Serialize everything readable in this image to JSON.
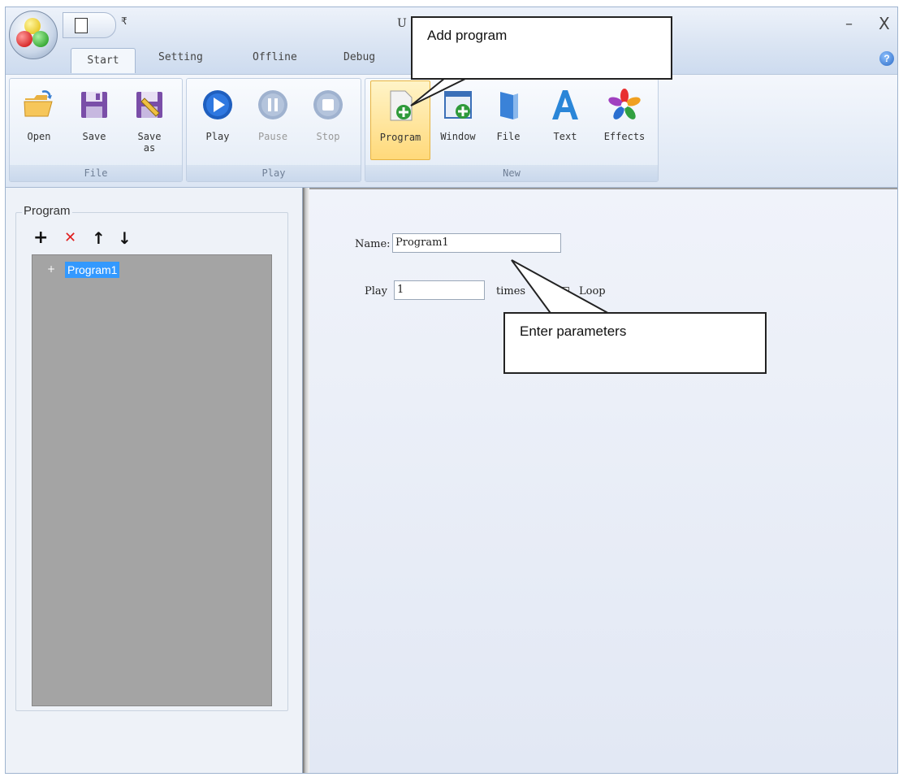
{
  "window": {
    "title": "U",
    "minimize_glyph": "–",
    "close_glyph": "X",
    "help_glyph": "?",
    "qat_dropdown_glyph": "₹"
  },
  "tabs": [
    "Start",
    "Setting",
    "Offline",
    "Debug"
  ],
  "ribbon": {
    "groups": {
      "file": {
        "label": "File",
        "buttons": [
          {
            "label": "Open",
            "icon": "folder-open-icon"
          },
          {
            "label": "Save",
            "icon": "floppy-disk-icon"
          },
          {
            "label": "Save\nas",
            "icon": "save-as-icon"
          }
        ]
      },
      "play": {
        "label": "Play",
        "buttons": [
          {
            "label": "Play",
            "icon": "play-icon"
          },
          {
            "label": "Pause",
            "icon": "pause-icon"
          },
          {
            "label": "Stop",
            "icon": "stop-icon"
          }
        ]
      },
      "new": {
        "label": "New",
        "buttons": [
          {
            "label": "Program",
            "icon": "new-program-icon"
          },
          {
            "label": "Window",
            "icon": "new-window-icon"
          },
          {
            "label": "File",
            "icon": "file-icon"
          },
          {
            "label": "Text",
            "icon": "text-icon"
          },
          {
            "label": "Effects",
            "icon": "effects-icon"
          }
        ]
      }
    }
  },
  "program_panel": {
    "title": "Program",
    "tools": {
      "add": "+",
      "delete": "✕",
      "up": "↑",
      "down": "↓"
    },
    "tree": [
      {
        "expand": "+",
        "label": "Program1"
      }
    ]
  },
  "form": {
    "name_label": "Name:",
    "name_value": "Program1",
    "play_label": "Play",
    "play_value": "1",
    "times_label": "times",
    "loop_label": "Loop"
  },
  "callouts": {
    "add_program": "Add program",
    "enter_parameters": "Enter parameters"
  },
  "colors": {
    "selection": "#3399ff",
    "tree_background": "#a4a4a4",
    "delete_red": "#e02020",
    "play_blue": "#1f5fbf"
  }
}
